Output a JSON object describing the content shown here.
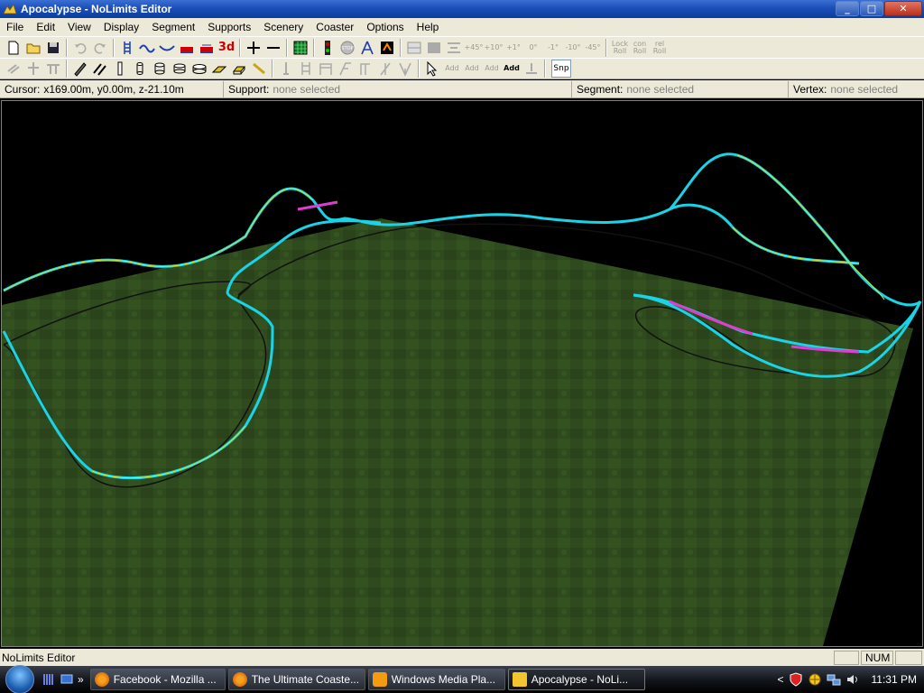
{
  "window": {
    "title": "Apocalypse - NoLimits Editor",
    "minimize": "_",
    "maximize": "□",
    "close": "✕"
  },
  "menu": [
    "File",
    "Edit",
    "View",
    "Display",
    "Segment",
    "Supports",
    "Scenery",
    "Coaster",
    "Options",
    "Help"
  ],
  "toolbar": {
    "three_d": "3d",
    "snap": "Snp",
    "rotations": [
      "+45°",
      "+10°",
      "+1°",
      "0°",
      "-1°",
      "-10°",
      "-45°"
    ],
    "lock_roll": [
      "Lock",
      "Roll"
    ],
    "con_roll": [
      "con",
      "Roll"
    ],
    "rel_roll": [
      "rel",
      "Roll"
    ],
    "add_labels": [
      "Add",
      "Add",
      "Add",
      "Add"
    ]
  },
  "infobar": {
    "cursor_label": "Cursor:",
    "cursor_value": "x169.00m, y0.00m, z-21.10m",
    "support_label": "Support:",
    "support_value": "none selected",
    "segment_label": "Segment:",
    "segment_value": "none selected",
    "vertex_label": "Vertex:",
    "vertex_value": "none selected"
  },
  "viewport": {
    "ground_color": "#2f4a1f",
    "track_rail_color": "#19d4e6",
    "track_highlight_color": "#c6e63a",
    "selected_segment_color": "#e03cd2",
    "shadow_color": "#111111"
  },
  "statusbar": {
    "text": "NoLimits Editor",
    "num": "NUM"
  },
  "taskbar": {
    "tasks": [
      {
        "label": "Facebook - Mozilla ...",
        "icon": "firefox-icon"
      },
      {
        "label": "The Ultimate Coaste...",
        "icon": "firefox-icon"
      },
      {
        "label": "Windows Media Pla...",
        "icon": "media-player-icon"
      },
      {
        "label": "Apocalypse - NoLi...",
        "icon": "nolimits-icon"
      }
    ],
    "chevron": "»",
    "tray_chevron": "<",
    "clock": "11:31 PM"
  }
}
